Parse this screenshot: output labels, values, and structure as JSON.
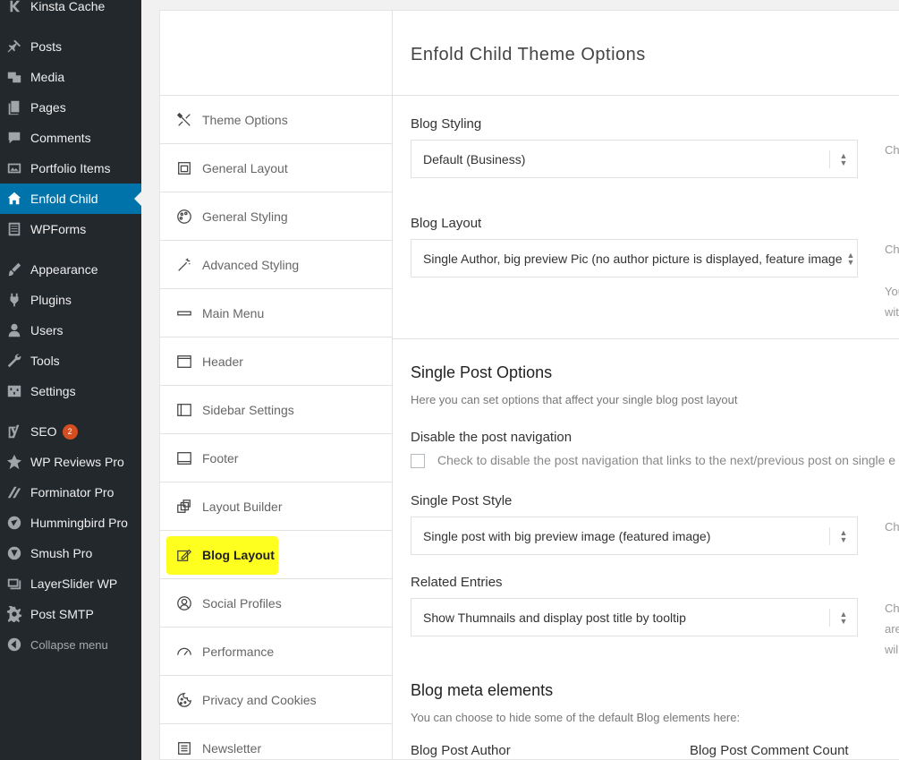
{
  "wp_menu": {
    "items": [
      {
        "label": "Kinsta Cache",
        "icon": "kinsta-icon"
      },
      {
        "label": "Posts",
        "icon": "pin-icon"
      },
      {
        "label": "Media",
        "icon": "media-icon"
      },
      {
        "label": "Pages",
        "icon": "pages-icon"
      },
      {
        "label": "Comments",
        "icon": "comment-icon"
      },
      {
        "label": "Portfolio Items",
        "icon": "portfolio-icon"
      },
      {
        "label": "Enfold Child",
        "icon": "home-icon"
      },
      {
        "label": "WPForms",
        "icon": "forms-icon"
      },
      {
        "label": "Appearance",
        "icon": "brush-icon"
      },
      {
        "label": "Plugins",
        "icon": "plugin-icon"
      },
      {
        "label": "Users",
        "icon": "user-icon"
      },
      {
        "label": "Tools",
        "icon": "wrench-icon"
      },
      {
        "label": "Settings",
        "icon": "settings-icon"
      },
      {
        "label": "SEO",
        "icon": "yoast-icon",
        "badge": "2"
      },
      {
        "label": "WP Reviews Pro",
        "icon": "star-icon"
      },
      {
        "label": "Forminator Pro",
        "icon": "forminator-icon"
      },
      {
        "label": "Hummingbird Pro",
        "icon": "hummingbird-icon"
      },
      {
        "label": "Smush Pro",
        "icon": "smush-icon"
      },
      {
        "label": "LayerSlider WP",
        "icon": "layers-icon"
      },
      {
        "label": "Post SMTP",
        "icon": "gear-icon"
      },
      {
        "label": "Collapse menu",
        "icon": "collapse-icon"
      }
    ]
  },
  "options_nav": {
    "items": [
      {
        "label": "Theme Options",
        "icon": "tools-icon"
      },
      {
        "label": "General Layout",
        "icon": "layout-icon"
      },
      {
        "label": "General Styling",
        "icon": "palette-icon"
      },
      {
        "label": "Advanced Styling",
        "icon": "magic-wand-icon"
      },
      {
        "label": "Main Menu",
        "icon": "menu-bar-icon"
      },
      {
        "label": "Header",
        "icon": "header-icon"
      },
      {
        "label": "Sidebar Settings",
        "icon": "sidebar-icon"
      },
      {
        "label": "Footer",
        "icon": "footer-icon"
      },
      {
        "label": "Layout Builder",
        "icon": "builder-icon"
      },
      {
        "label": "Blog Layout",
        "icon": "blog-edit-icon"
      },
      {
        "label": "Social Profiles",
        "icon": "social-icon"
      },
      {
        "label": "Performance",
        "icon": "gauge-icon"
      },
      {
        "label": "Privacy and Cookies",
        "icon": "cookie-icon"
      },
      {
        "label": "Newsletter",
        "icon": "newsletter-icon"
      }
    ]
  },
  "main": {
    "title": "Enfold Child Theme Options",
    "blog_styling": {
      "label": "Blog Styling",
      "value": "Default (Business)",
      "side": "Ch"
    },
    "blog_layout": {
      "label": "Blog Layout",
      "value": "Single Author, big preview Pic (no author picture is displayed, feature image",
      "side1": "Ch",
      "side2": "You",
      "side3": "wit"
    },
    "single_post_options": {
      "title": "Single Post Options",
      "desc": "Here you can set options that affect your single blog post layout"
    },
    "disable_nav": {
      "label": "Disable the post navigation",
      "checkbox_text": "Check to disable the post navigation that links to the next/previous post on single e"
    },
    "single_post_style": {
      "label": "Single Post Style",
      "value": "Single post with big preview image (featured image)",
      "side": "Ch"
    },
    "related_entries": {
      "label": "Related Entries",
      "value": "Show Thumnails and display post title by tooltip",
      "side1": "Ch",
      "side2": "are",
      "side3": "wil"
    },
    "blog_meta": {
      "title": "Blog meta elements",
      "desc": "You can choose to hide some of the default Blog elements here:",
      "col1": "Blog Post Author",
      "col2": "Blog Post Comment Count"
    }
  }
}
